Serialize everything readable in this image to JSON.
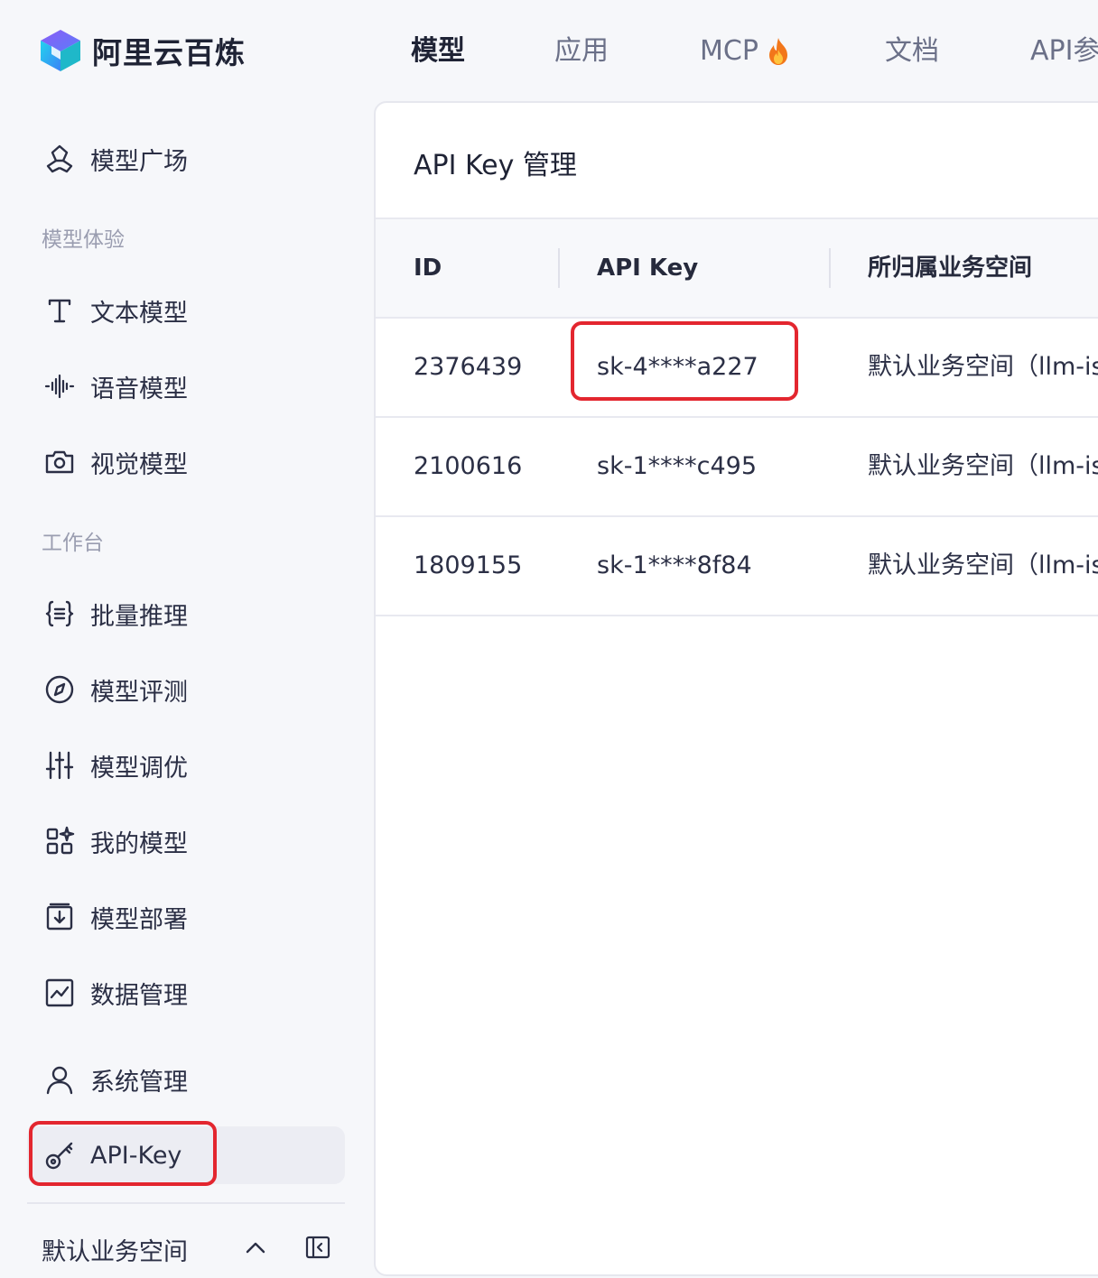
{
  "brand": {
    "name": "阿里云百炼"
  },
  "topnav": [
    {
      "label": "模型",
      "active": true
    },
    {
      "label": "应用"
    },
    {
      "label": "MCP",
      "icon": "fire-icon"
    },
    {
      "label": "文档"
    },
    {
      "label": "API参"
    }
  ],
  "sidebar": {
    "top_item": {
      "label": "模型广场",
      "icon": "model-plaza-icon"
    },
    "groups": [
      {
        "title": "模型体验",
        "items": [
          {
            "label": "文本模型",
            "icon": "text-icon"
          },
          {
            "label": "语音模型",
            "icon": "waveform-icon"
          },
          {
            "label": "视觉模型",
            "icon": "camera-icon"
          }
        ]
      },
      {
        "title": "工作台",
        "items": [
          {
            "label": "批量推理",
            "icon": "braces-icon"
          },
          {
            "label": "模型评测",
            "icon": "compass-icon"
          },
          {
            "label": "模型调优",
            "icon": "sliders-icon"
          },
          {
            "label": "我的模型",
            "icon": "grid-icon"
          },
          {
            "label": "模型部署",
            "icon": "deploy-icon"
          },
          {
            "label": "数据管理",
            "icon": "chart-icon"
          }
        ]
      }
    ],
    "bottom_items": [
      {
        "label": "系统管理",
        "icon": "user-icon"
      },
      {
        "label": "API-Key",
        "icon": "key-icon",
        "active": true
      }
    ],
    "workspace": {
      "label": "默认业务空间"
    }
  },
  "main": {
    "title": "API Key 管理",
    "columns": [
      "ID",
      "API Key",
      "所归属业务空间"
    ],
    "rows": [
      {
        "id": "2376439",
        "key": "sk-4****a227",
        "space": "默认业务空间（llm-is"
      },
      {
        "id": "2100616",
        "key": "sk-1****c495",
        "space": "默认业务空间（llm-is"
      },
      {
        "id": "1809155",
        "key": "sk-1****8f84",
        "space": "默认业务空间（llm-is"
      }
    ]
  },
  "colors": {
    "highlight": "#e3262f",
    "accent_purple": "#7b5cf5",
    "accent_cyan": "#2cc9d8"
  }
}
